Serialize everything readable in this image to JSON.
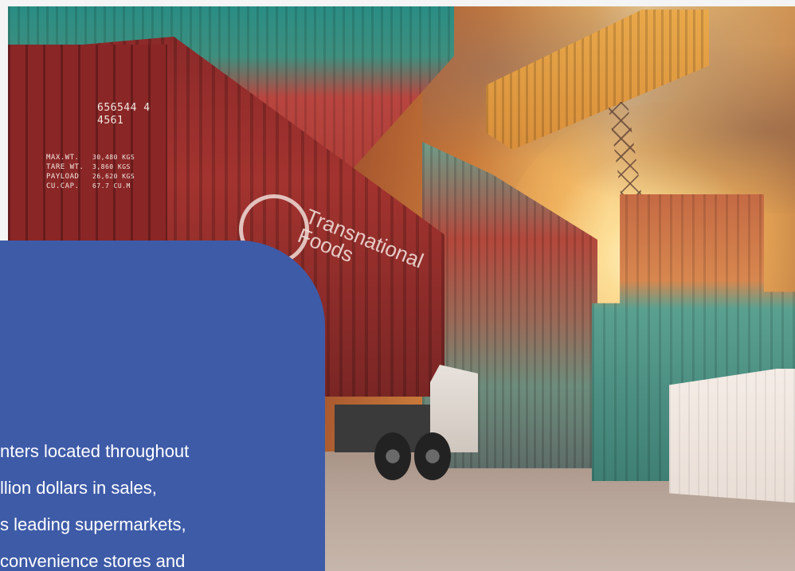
{
  "photo": {
    "icon": "shipping-container-yard-photo",
    "door_marking_lines": [
      "656544 4",
      "4561"
    ],
    "door_spec_labels": [
      "MAX.WT.",
      "TARE WT.",
      "PAYLOAD",
      "CU.CAP."
    ],
    "door_spec_values": [
      "30,480 KGS",
      "3,860 KGS",
      "26,620 KGS",
      "67.7 CU.M"
    ],
    "container_brand": [
      "Transnational",
      "Foods"
    ]
  },
  "card": {
    "lines": [
      "nters located throughout",
      "llion dollars in sales,",
      "s leading supermarkets,",
      "convenience stores and"
    ]
  },
  "colors": {
    "card_background": "#3e5ba8",
    "card_text": "#ffffff"
  }
}
